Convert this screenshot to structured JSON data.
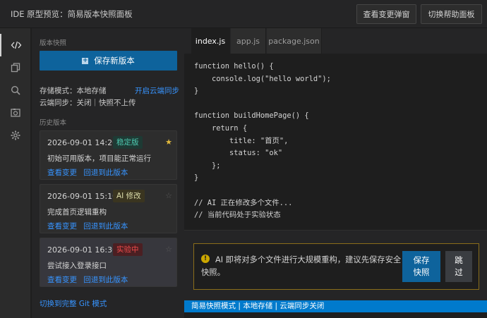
{
  "header": {
    "title": "IDE 原型预览：简易版本快照面板",
    "view_changes_popup": "查看变更弹窗",
    "toggle_help_panel": "切换帮助面板"
  },
  "activity_bar": {
    "items": [
      "code-icon",
      "copy-icon",
      "search-icon",
      "camera-icon",
      "gear-icon"
    ]
  },
  "sidebar": {
    "section_label": "版本快照",
    "save_button": "保存新版本",
    "storage_mode": "存储模式：本地存储",
    "enable_cloud_sync": "开启云端同步",
    "cloud_sync_status": "云端同步：关闭｜快照不上传",
    "history_label": "历史版本",
    "snapshots": [
      {
        "time": "2026-09-01 14:20",
        "badge": "稳定版",
        "badge_color": "#4ec9b0",
        "starred": true,
        "description": "初始可用版本，项目能正常运行",
        "view": "查看变更",
        "rollback": "回退到此版本"
      },
      {
        "time": "2026-09-01 15:10",
        "badge": "AI 修改",
        "badge_color": "#dcdcaa",
        "starred": false,
        "description": "完成首页逻辑重构",
        "view": "查看变更",
        "rollback": "回退到此版本"
      },
      {
        "time": "2026-09-01 16:30",
        "badge": "实验中",
        "badge_color": "#f14c4c",
        "starred": false,
        "description": "尝试接入登录接口",
        "view": "查看变更",
        "rollback": "回退到此版本"
      }
    ],
    "git_mode_link": "切换到完整 Git 模式"
  },
  "editor": {
    "tabs": [
      "index.js",
      "app.js",
      "package.json"
    ],
    "active_tab": "index.js",
    "code_lines": [
      "function hello() {",
      "    console.log(\"hello world\");",
      "}",
      "",
      "function buildHomePage() {",
      "    return {",
      "        title: \"首页\",",
      "        status: \"ok\"",
      "    };",
      "}",
      "",
      "// AI 正在修改多个文件...",
      "// 当前代码处于实验状态"
    ]
  },
  "notice": {
    "message": "AI 即将对多个文件进行大规模重构，建议先保存安全快照。",
    "save_snapshot_button": "保存快照",
    "skip_button": "跳过"
  },
  "statusbar": {
    "text": "简易快照模式 | 本地存储 | 云端同步关闭"
  },
  "colors": {
    "accent": "#0e639c",
    "statusbar": "#007acc",
    "link": "#3794ff",
    "star": "#e2b93d"
  }
}
